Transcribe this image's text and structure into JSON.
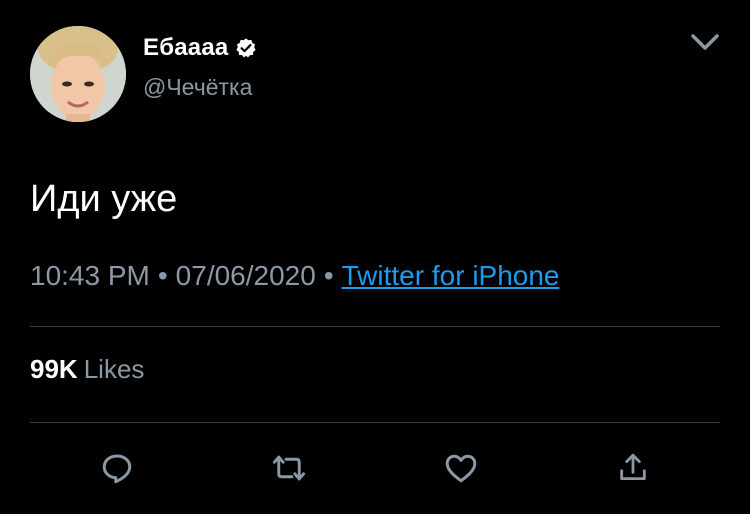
{
  "user": {
    "display_name": "Ебаааа",
    "handle": "@Чечётка",
    "verified": true,
    "avatar_icon": "profile-photo"
  },
  "tweet": {
    "text": "Иди уже",
    "time": "10:43 PM",
    "separator": "•",
    "date": "07/06/2020",
    "source": "Twitter for iPhone"
  },
  "stats": {
    "likes_count": "99K",
    "likes_label": "Likes"
  },
  "actions": {
    "reply_icon": "reply-icon",
    "retweet_icon": "retweet-icon",
    "like_icon": "heart-icon",
    "share_icon": "share-icon"
  },
  "colors": {
    "background": "#000000",
    "primary_text": "#ffffff",
    "secondary_text": "#8b98a5",
    "link": "#1d9bf0",
    "divider": "#38444d"
  }
}
